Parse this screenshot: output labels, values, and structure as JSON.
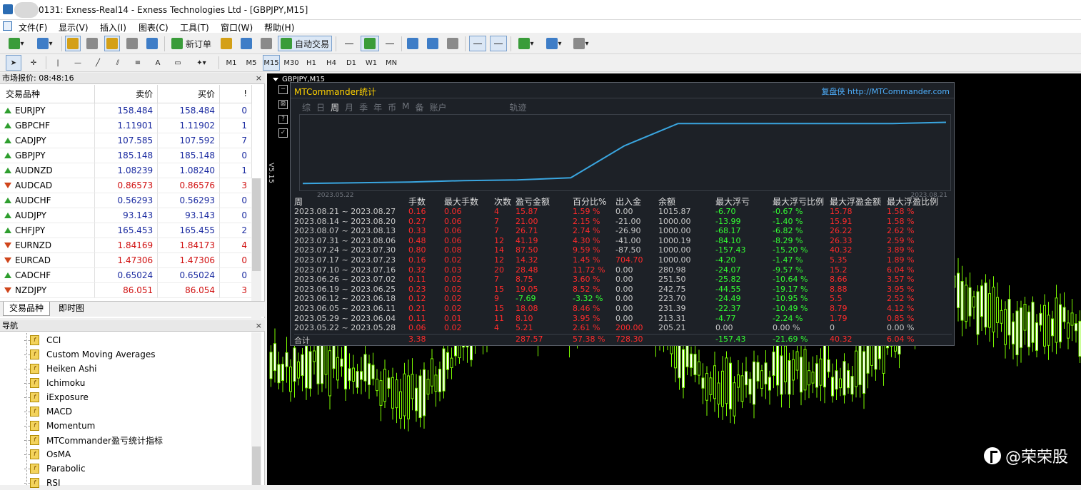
{
  "window": {
    "title": "0131: Exness-Real14 - Exness Technologies Ltd - [GBPJPY,M15]"
  },
  "menu": [
    "文件(F)",
    "显示(V)",
    "插入(I)",
    "图表(C)",
    "工具(T)",
    "窗口(W)",
    "帮助(H)"
  ],
  "toolbar": {
    "new_order": "新订单",
    "auto_trade": "自动交易"
  },
  "timeframes": [
    "M1",
    "M5",
    "M15",
    "M30",
    "H1",
    "H4",
    "D1",
    "W1",
    "MN"
  ],
  "active_timeframe": "M15",
  "market_watch": {
    "title": "市场报价: 08:48:16",
    "columns": [
      "交易品种",
      "卖价",
      "买价",
      "!"
    ],
    "rows": [
      {
        "symbol": "EURJPY",
        "bid": "158.484",
        "ask": "158.484",
        "spread": "0",
        "dir": "up"
      },
      {
        "symbol": "GBPCHF",
        "bid": "1.11901",
        "ask": "1.11902",
        "spread": "1",
        "dir": "up"
      },
      {
        "symbol": "CADJPY",
        "bid": "107.585",
        "ask": "107.592",
        "spread": "7",
        "dir": "up"
      },
      {
        "symbol": "GBPJPY",
        "bid": "185.148",
        "ask": "185.148",
        "spread": "0",
        "dir": "up"
      },
      {
        "symbol": "AUDNZD",
        "bid": "1.08239",
        "ask": "1.08240",
        "spread": "1",
        "dir": "up"
      },
      {
        "symbol": "AUDCAD",
        "bid": "0.86573",
        "ask": "0.86576",
        "spread": "3",
        "dir": "down"
      },
      {
        "symbol": "AUDCHF",
        "bid": "0.56293",
        "ask": "0.56293",
        "spread": "0",
        "dir": "up"
      },
      {
        "symbol": "AUDJPY",
        "bid": "93.143",
        "ask": "93.143",
        "spread": "0",
        "dir": "up"
      },
      {
        "symbol": "CHFJPY",
        "bid": "165.453",
        "ask": "165.455",
        "spread": "2",
        "dir": "up"
      },
      {
        "symbol": "EURNZD",
        "bid": "1.84169",
        "ask": "1.84173",
        "spread": "4",
        "dir": "down"
      },
      {
        "symbol": "EURCAD",
        "bid": "1.47306",
        "ask": "1.47306",
        "spread": "0",
        "dir": "down"
      },
      {
        "symbol": "CADCHF",
        "bid": "0.65024",
        "ask": "0.65024",
        "spread": "0",
        "dir": "up"
      },
      {
        "symbol": "NZDJPY",
        "bid": "86.051",
        "ask": "86.054",
        "spread": "3",
        "dir": "down"
      }
    ],
    "tabs": [
      "交易品种",
      "即时图"
    ]
  },
  "navigator": {
    "title": "导航",
    "items": [
      "CCI",
      "Custom Moving Averages",
      "Heiken Ashi",
      "Ichimoku",
      "iExposure",
      "MACD",
      "Momentum",
      "MTCommander盈亏统计指标",
      "OsMA",
      "Parabolic",
      "RSI"
    ]
  },
  "chart": {
    "label": "GBPJPY,M15"
  },
  "mtc": {
    "title": "MTCommander统计",
    "brand": "复盘侠",
    "url": "http://MTCommander.com",
    "version": "V5.15",
    "side_buttons": [
      "−",
      "⊠",
      "?",
      "✓"
    ],
    "tabs": [
      "综",
      "日",
      "周",
      "月",
      "季",
      "年",
      "币",
      "M",
      "备",
      "账户",
      "轨迹"
    ],
    "active_tab": "周",
    "plot_start": "2023.05.22",
    "plot_end": "2023.08.21",
    "equity_curve": [
      205.21,
      213.31,
      223.7,
      242.75,
      251.5,
      280.98,
      704.7,
      1000,
      1000,
      1000.19,
      1000,
      1000,
      1015.87
    ],
    "headers": [
      "周",
      "手数",
      "最大手数",
      "次数",
      "盈亏金额",
      "百分比%",
      "出入金",
      "余额",
      "最大浮亏",
      "最大浮亏比例",
      "最大浮盈金额",
      "最大浮盈比例"
    ],
    "rows": [
      [
        "2023.08.21 ~ 2023.08.27",
        "0.16",
        "0.06",
        "4",
        "15.87",
        "1.59 %",
        "0.00",
        "1015.87",
        "-6.70",
        "-0.67 %",
        "15.78",
        "1.58 %"
      ],
      [
        "2023.08.14 ~ 2023.08.20",
        "0.27",
        "0.06",
        "7",
        "21.00",
        "2.15 %",
        "-21.00",
        "1000.00",
        "-13.99",
        "-1.40 %",
        "15.91",
        "1.58 %"
      ],
      [
        "2023.08.07 ~ 2023.08.13",
        "0.33",
        "0.06",
        "7",
        "26.71",
        "2.74 %",
        "-26.90",
        "1000.00",
        "-68.17",
        "-6.82 %",
        "26.22",
        "2.62 %"
      ],
      [
        "2023.07.31 ~ 2023.08.06",
        "0.48",
        "0.06",
        "12",
        "41.19",
        "4.30 %",
        "-41.00",
        "1000.19",
        "-84.10",
        "-8.29 %",
        "26.33",
        "2.59 %"
      ],
      [
        "2023.07.24 ~ 2023.07.30",
        "0.80",
        "0.08",
        "14",
        "87.50",
        "9.59 %",
        "-87.50",
        "1000.00",
        "-157.43",
        "-15.20 %",
        "40.32",
        "3.89 %"
      ],
      [
        "2023.07.17 ~ 2023.07.23",
        "0.16",
        "0.02",
        "12",
        "14.32",
        "1.45 %",
        "704.70",
        "1000.00",
        "-4.20",
        "-1.47 %",
        "5.35",
        "1.89 %"
      ],
      [
        "2023.07.10 ~ 2023.07.16",
        "0.32",
        "0.03",
        "20",
        "28.48",
        "11.72 %",
        "0.00",
        "280.98",
        "-24.07",
        "-9.57 %",
        "15.2",
        "6.04 %"
      ],
      [
        "2023.06.26 ~ 2023.07.02",
        "0.11",
        "0.02",
        "7",
        "8.75",
        "3.60 %",
        "0.00",
        "251.50",
        "-25.82",
        "-10.64 %",
        "8.66",
        "3.57 %"
      ],
      [
        "2023.06.19 ~ 2023.06.25",
        "0.23",
        "0.02",
        "15",
        "19.05",
        "8.52 %",
        "0.00",
        "242.75",
        "-44.55",
        "-19.17 %",
        "8.88",
        "3.95 %"
      ],
      [
        "2023.06.12 ~ 2023.06.18",
        "0.12",
        "0.02",
        "9",
        "-7.69",
        "-3.32 %",
        "0.00",
        "223.70",
        "-24.49",
        "-10.95 %",
        "5.5",
        "2.52 %"
      ],
      [
        "2023.06.05 ~ 2023.06.11",
        "0.21",
        "0.02",
        "15",
        "18.08",
        "8.46 %",
        "0.00",
        "231.39",
        "-22.37",
        "-10.49 %",
        "8.79",
        "4.12 %"
      ],
      [
        "2023.05.29 ~ 2023.06.04",
        "0.11",
        "0.01",
        "11",
        "8.10",
        "3.95 %",
        "0.00",
        "213.31",
        "-4.77",
        "-2.24 %",
        "1.79",
        "0.85 %"
      ],
      [
        "2023.05.22 ~ 2023.05.28",
        "0.06",
        "0.02",
        "4",
        "5.21",
        "2.61 %",
        "200.00",
        "205.21",
        "0.00",
        "0.00 %",
        "0",
        "0.00 %"
      ]
    ],
    "total": [
      "合计",
      "3.38",
      "",
      "",
      "287.57",
      "57.38 %",
      "728.30",
      "",
      "-157.43",
      "-21.69 %",
      "40.32",
      "6.04 %"
    ]
  },
  "watermark": "@荣荣股"
}
